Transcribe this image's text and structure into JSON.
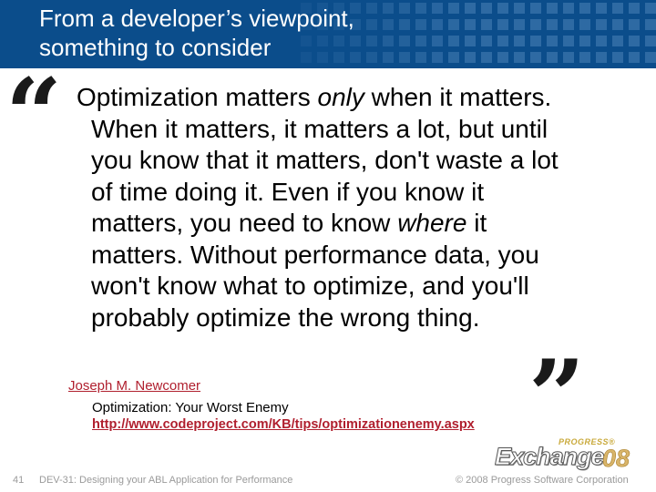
{
  "header": {
    "title_line1": "From a developer’s viewpoint,",
    "title_line2": "something to consider",
    "background_color": "#0b4d8b"
  },
  "quote": {
    "open_mark": "“",
    "close_mark": "”",
    "lines": [
      {
        "before": "Optimization matters ",
        "em": "only",
        "after": " when it matters."
      },
      {
        "before": "When it matters, it matters a lot, but until",
        "em": "",
        "after": ""
      },
      {
        "before": "you know that it matters, don't waste a lot",
        "em": "",
        "after": ""
      },
      {
        "before": "of time doing it. Even if you know it",
        "em": "",
        "after": ""
      },
      {
        "before": "matters, you need to know ",
        "em": "where",
        "after": " it"
      },
      {
        "before": "matters. Without performance data, you",
        "em": "",
        "after": ""
      },
      {
        "before": "won't know what to optimize, and you'll",
        "em": "",
        "after": ""
      },
      {
        "before": "probably optimize the wrong thing.",
        "em": "",
        "after": ""
      }
    ]
  },
  "attribution": {
    "author": "Joseph M. Newcomer",
    "source_title": "Optimization: Your Worst Enemy",
    "source_url": "http://www.codeproject.com/KB/tips/optimizationenemy.aspx",
    "link_color": "#b01f2e"
  },
  "footer": {
    "slide_number": "41",
    "session_title": "DEV-31: Designing your ABL Application for Performance",
    "copyright": "© 2008 Progress Software Corporation"
  },
  "logo": {
    "brand": "PROGRESS®",
    "name": "Exchange",
    "year": "08"
  }
}
